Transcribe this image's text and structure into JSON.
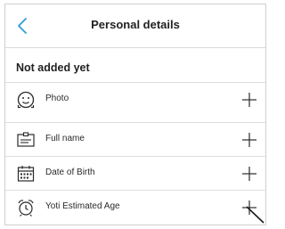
{
  "header": {
    "title": "Personal details"
  },
  "section": {
    "heading": "Not added yet"
  },
  "items": [
    {
      "label": "Photo",
      "icon": "face-icon"
    },
    {
      "label": "Full name",
      "icon": "id-card-icon"
    },
    {
      "label": "Date of Birth",
      "icon": "calendar-icon"
    },
    {
      "label": "Yoti Estimated Age",
      "icon": "alarm-clock-icon"
    }
  ],
  "colors": {
    "accent": "#2d9fd8",
    "text": "#2a2a2a",
    "divider": "#dedede"
  }
}
